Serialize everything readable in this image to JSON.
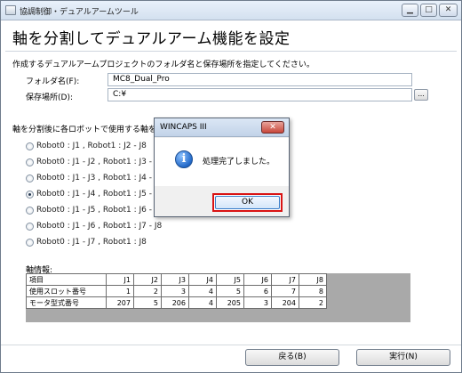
{
  "window": {
    "title": "協調制御・デュアルアームツール",
    "min_label": "▁",
    "max_label": "□",
    "close_label": "✕"
  },
  "page": {
    "heading": "軸を分割してデュアルアーム機能を設定",
    "instruction": "作成するデュアルアームプロジェクトのフォルダ名と保存場所を指定してください。"
  },
  "fields": {
    "folder_label": "フォルダ名(F):",
    "folder_value": "MC8_Dual_Pro",
    "location_label": "保存場所(D):",
    "location_value": "C:¥",
    "browse_label": "..."
  },
  "axis_prompt": "軸を分割後に各ロボットで使用する軸を",
  "options": [
    {
      "label": "Robot0 : J1 , Robot1 : J2 - J8",
      "checked": false
    },
    {
      "label": "Robot0 : J1 - J2 , Robot1 : J3 - J8",
      "checked": false
    },
    {
      "label": "Robot0 : J1 - J3 , Robot1 : J4 - J8",
      "checked": false
    },
    {
      "label": "Robot0 : J1 - J4 , Robot1 : J5 - J8",
      "checked": true
    },
    {
      "label": "Robot0 : J1 - J5 , Robot1 : J6 - J8",
      "checked": false
    },
    {
      "label": "Robot0 : J1 - J6 , Robot1 : J7 - J8",
      "checked": false
    },
    {
      "label": "Robot0 : J1 - J7 , Robot1 : J8",
      "checked": false
    }
  ],
  "axis_info": {
    "label": "軸情報:",
    "header": [
      "項目",
      "J1",
      "J2",
      "J3",
      "J4",
      "J5",
      "J6",
      "J7",
      "J8"
    ],
    "rows": [
      [
        "使用スロット番号",
        "1",
        "2",
        "3",
        "4",
        "5",
        "6",
        "7",
        "8"
      ],
      [
        "モータ型式番号",
        "207",
        "5",
        "206",
        "4",
        "205",
        "3",
        "204",
        "2"
      ]
    ]
  },
  "footer": {
    "back_label": "戻る(B)",
    "run_label": "実行(N)"
  },
  "dialog": {
    "title": "WINCAPS III",
    "message": "処理完了しました。",
    "ok_label": "OK",
    "close_label": "✕",
    "icon_glyph": "i"
  }
}
